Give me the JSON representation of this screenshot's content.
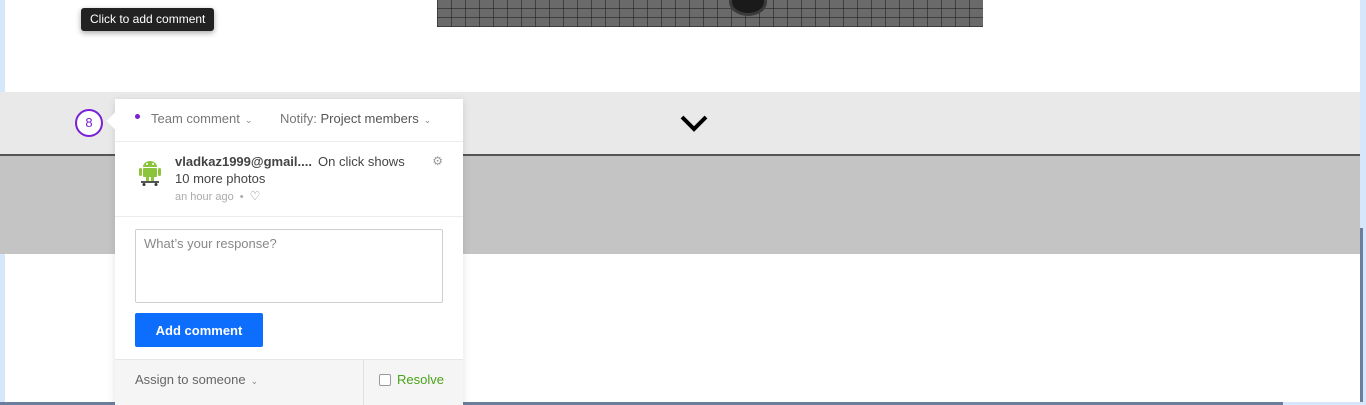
{
  "tooltip": {
    "text": "Click to add comment"
  },
  "pin": {
    "number": "8",
    "color": "#7a21d4"
  },
  "panel": {
    "type_label": "Team comment",
    "notify_prefix": "Notify:",
    "notify_value": "Project members",
    "comment": {
      "author": "vladkaz1999@gmail....",
      "text_line1": "On click shows",
      "text_line2": "10 more photos",
      "time": "an hour ago",
      "separator": "•"
    },
    "response_placeholder": "What’s your response?",
    "add_button_label": "Add comment",
    "assign_label": "Assign to someone",
    "resolve_label": "Resolve"
  },
  "icons": {
    "type_chevron": "chevron-down-icon",
    "notify_chevron": "chevron-down-icon",
    "assign_chevron": "chevron-down-icon",
    "collapse": "chevron-down-icon",
    "gear": "gear-icon",
    "like": "heart-icon",
    "avatar": "android-avatar"
  },
  "colors": {
    "accent": "#7a21d4",
    "button": "#0d6efd",
    "resolve": "#4aa31a"
  }
}
